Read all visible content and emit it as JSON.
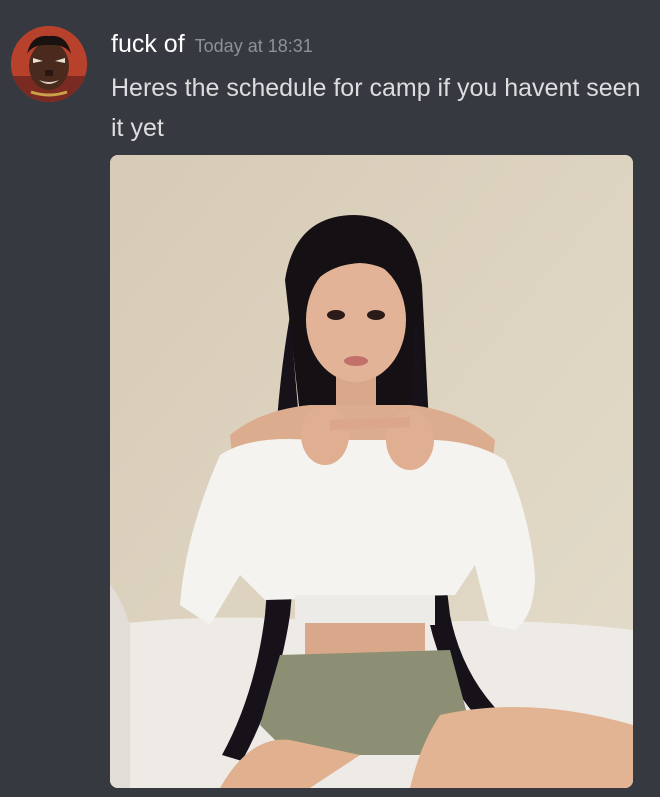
{
  "message": {
    "author": "fuck of",
    "timestamp": "Today at 18:31",
    "text": "Heres the schedule for camp if you havent seen it yet"
  },
  "colors": {
    "background": "#36393f",
    "username": "#ffffff",
    "timestamp": "#8e9297",
    "text": "#dcddde"
  },
  "icons": {
    "avatar": "user-avatar-portrait",
    "attachment": "photo-attachment"
  }
}
